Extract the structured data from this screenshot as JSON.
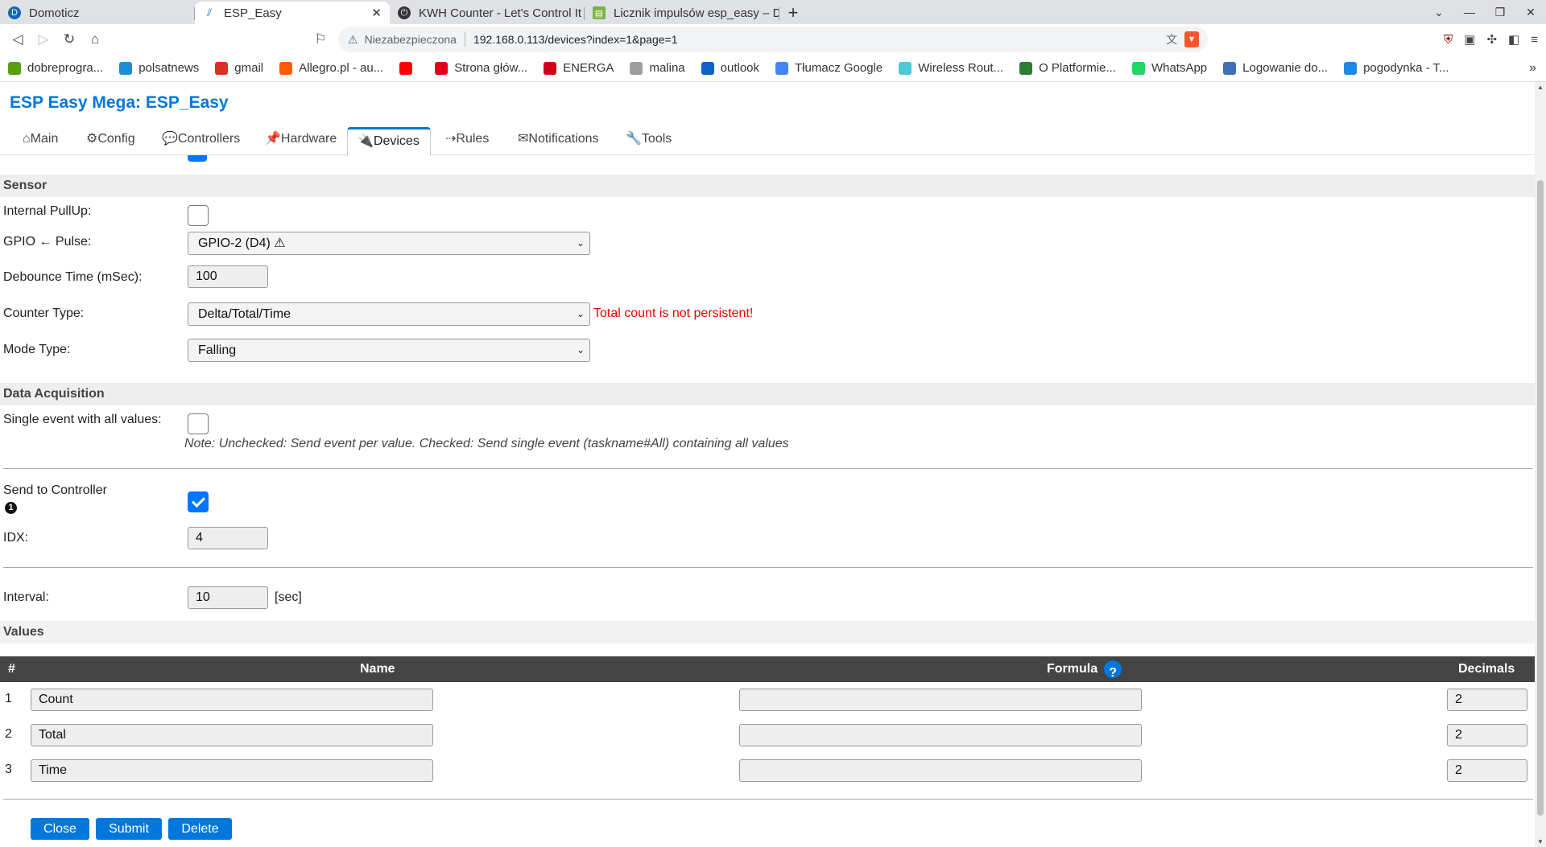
{
  "browser": {
    "tabs": [
      {
        "title": "Domoticz",
        "active": false
      },
      {
        "title": "ESP_Easy",
        "active": true
      },
      {
        "title": "KWH Counter - Let's Control It",
        "active": false
      },
      {
        "title": "Licznik impulsów esp_easy – D",
        "active": false
      }
    ],
    "new_tab": "+",
    "address": {
      "security": "Niezabezpieczona",
      "url": "192.168.0.113/devices?index=1&page=1"
    },
    "bookmarks": [
      {
        "label": "dobreprogra...",
        "icon": "dp-icon",
        "color": "#5a9e12"
      },
      {
        "label": "polsatnews",
        "icon": "polsatnews-icon",
        "color": "#1a8fd8"
      },
      {
        "label": "gmail",
        "icon": "gmail-icon",
        "color": "#d93025"
      },
      {
        "label": "Allegro.pl - au...",
        "icon": "allegro-icon",
        "color": "#ff5a00"
      },
      {
        "label": "",
        "icon": "youtube-icon",
        "color": "#ff0000"
      },
      {
        "label": "Strona głów...",
        "icon": "tauron-icon",
        "color": "#e2001a"
      },
      {
        "label": "ENERGA",
        "icon": "energa-icon",
        "color": "#d0021b"
      },
      {
        "label": "malina",
        "icon": "folder-icon",
        "color": "#9e9e9e"
      },
      {
        "label": "outlook",
        "icon": "outlook-icon",
        "color": "#0a64c8"
      },
      {
        "label": "Tłumacz Google",
        "icon": "translate-icon",
        "color": "#4285f4"
      },
      {
        "label": "Wireless Rout...",
        "icon": "tplink-icon",
        "color": "#4acbd6"
      },
      {
        "label": "O Platformie...",
        "icon": "platform-icon",
        "color": "#2e7d32"
      },
      {
        "label": "WhatsApp",
        "icon": "whatsapp-icon",
        "color": "#25d366"
      },
      {
        "label": "Logowanie do...",
        "icon": "login-icon",
        "color": "#3f6fb5"
      },
      {
        "label": "pogodynka - T...",
        "icon": "chat-icon",
        "color": "#1e88e5"
      }
    ]
  },
  "app": {
    "title": "ESP Easy Mega: ESP_Easy",
    "menu": [
      {
        "label": "⌂Main",
        "active": false
      },
      {
        "label": "⚙Config",
        "active": false
      },
      {
        "label": "💬Controllers",
        "active": false
      },
      {
        "label": "📌Hardware",
        "active": false
      },
      {
        "label": "🔌Devices",
        "active": true
      },
      {
        "label": "⇢Rules",
        "active": false
      },
      {
        "label": "✉Notifications",
        "active": false
      },
      {
        "label": "🔧Tools",
        "active": false
      }
    ]
  },
  "sensor": {
    "header": "Sensor",
    "pullup_label": "Internal PullUp:",
    "pullup_checked": false,
    "gpio_label": "GPIO ← Pulse:",
    "gpio_value": "GPIO-2 (D4) ⚠",
    "debounce_label": "Debounce Time (mSec):",
    "debounce_value": "100",
    "counter_label": "Counter Type:",
    "counter_value": "Delta/Total/Time",
    "counter_warning": "Total count is not persistent!",
    "mode_label": "Mode Type:",
    "mode_value": "Falling"
  },
  "data_acq": {
    "header": "Data Acquisition",
    "single_event_label": "Single event with all values:",
    "single_event_checked": false,
    "single_event_note": "Note: Unchecked: Send event per value. Checked: Send single event (taskname#All) containing all values",
    "send_label": "Send to Controller",
    "send_info_icon": "1",
    "send_checked": true,
    "idx_label": "IDX:",
    "idx_value": "4",
    "interval_label": "Interval:",
    "interval_value": "10",
    "interval_unit": "[sec]"
  },
  "values": {
    "header": "Values",
    "columns": {
      "num": "#",
      "name": "Name",
      "formula": "Formula",
      "formula_help": "?",
      "decimals": "Decimals"
    },
    "rows": [
      {
        "num": "1",
        "name": "Count",
        "formula": "",
        "decimals": "2"
      },
      {
        "num": "2",
        "name": "Total",
        "formula": "",
        "decimals": "2"
      },
      {
        "num": "3",
        "name": "Time",
        "formula": "",
        "decimals": "2"
      }
    ]
  },
  "buttons": {
    "close": "Close",
    "submit": "Submit",
    "delete": "Delete"
  },
  "colors": {
    "accent": "#0077dd",
    "warning": "#ee0000",
    "header_bg": "#444444",
    "section_bg": "#eeeeee"
  }
}
